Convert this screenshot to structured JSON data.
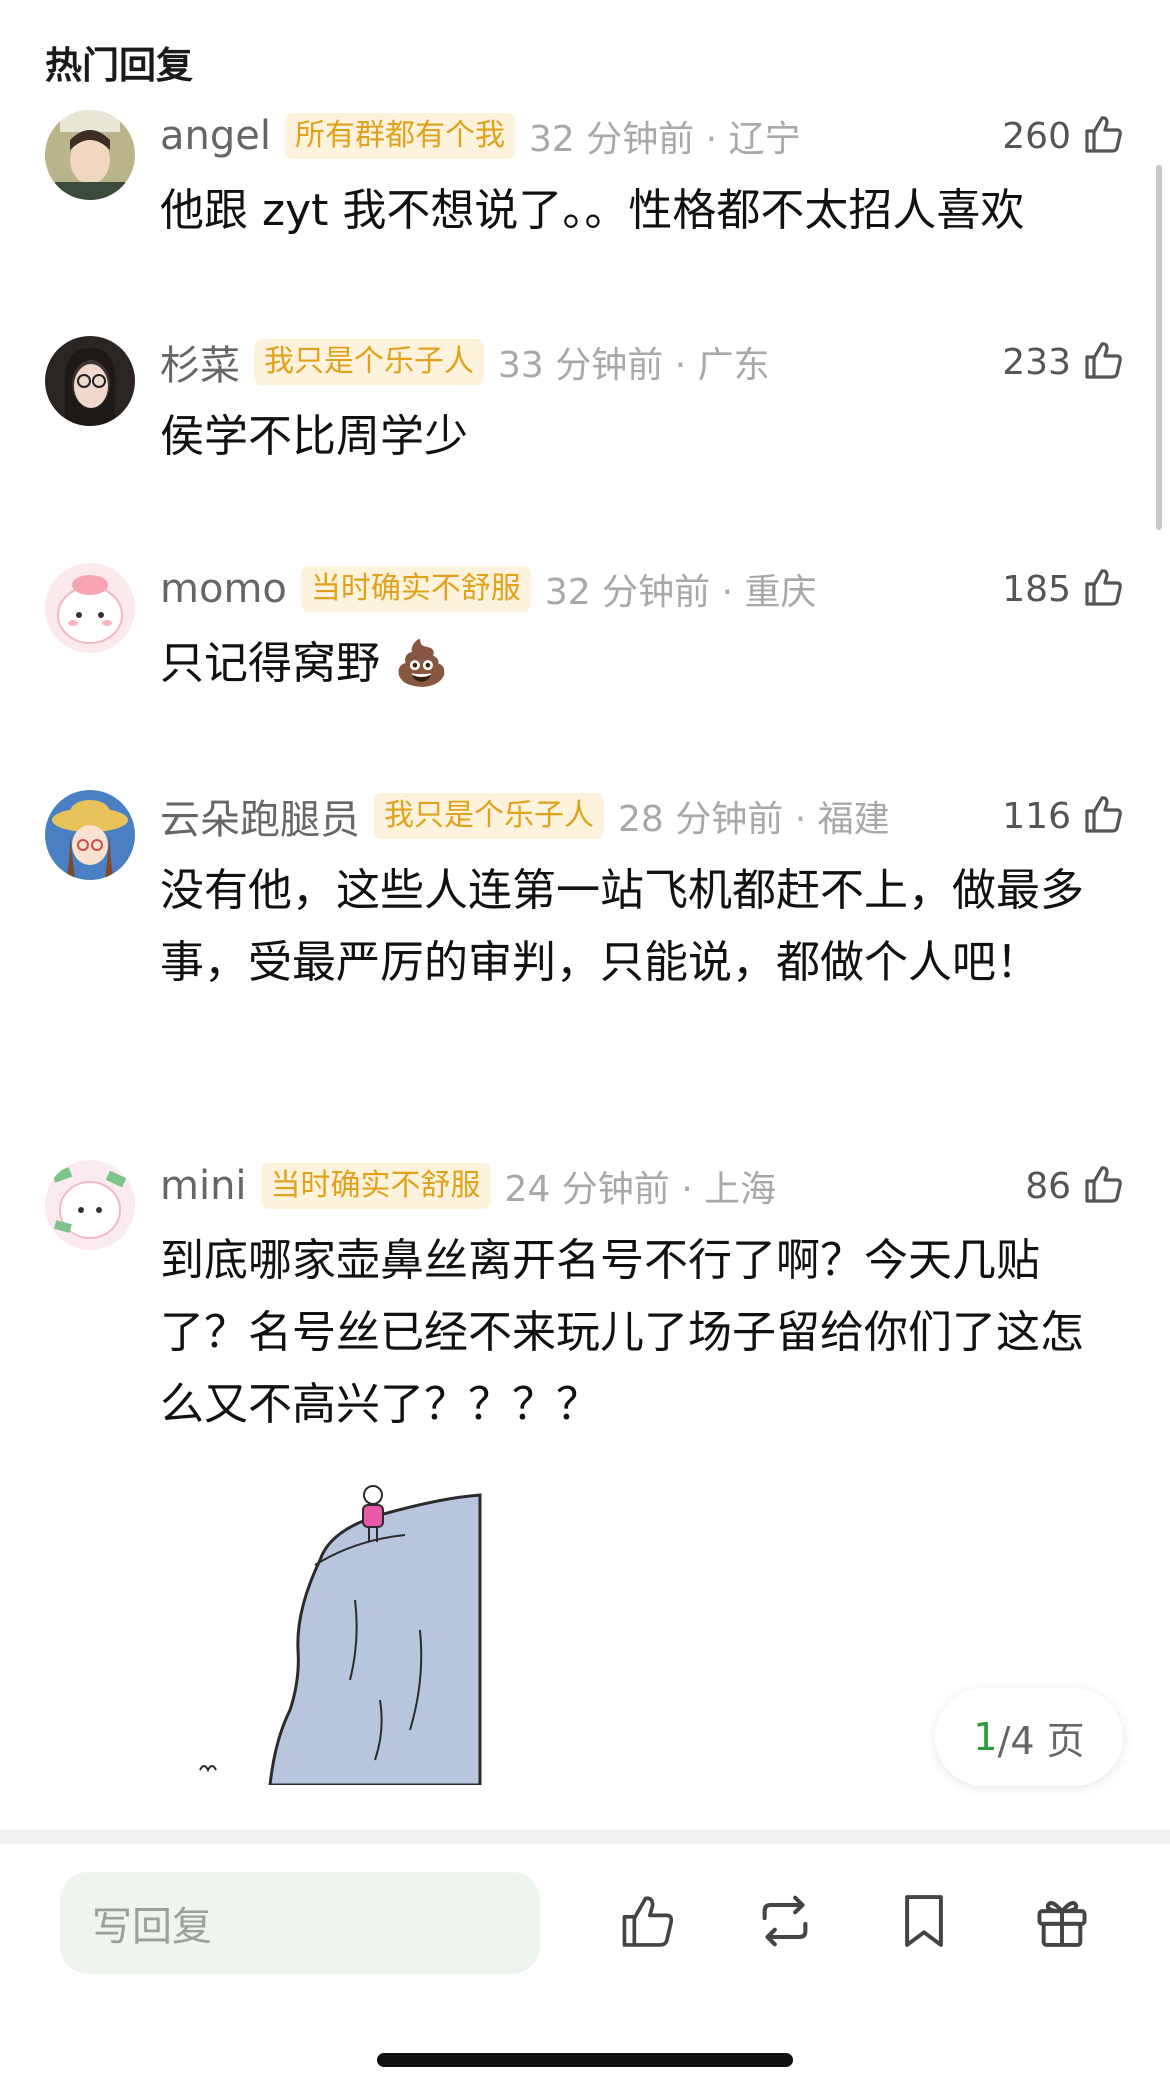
{
  "section": {
    "title": "热门回复"
  },
  "comments": [
    {
      "username": "angel",
      "badge": "所有群都有个我",
      "time_location": "32 分钟前 · 辽宁",
      "likes": "260",
      "text": "他跟 zyt 我不想说了。。性格都不太招人喜欢",
      "avatar": "avatar-girl-hat"
    },
    {
      "username": "杉菜",
      "badge": "我只是个乐子人",
      "time_location": "33 分钟前 · 广东",
      "likes": "233",
      "text": "侯学不比周学少",
      "avatar": "avatar-girl-glasses"
    },
    {
      "username": "momo",
      "badge": "当时确实不舒服",
      "time_location": "32 分钟前 · 重庆",
      "likes": "185",
      "text": "只记得窝野 💩",
      "avatar": "avatar-pink-cartoon"
    },
    {
      "username": "云朵跑腿员",
      "badge": "我只是个乐子人",
      "time_location": "28 分钟前 · 福建",
      "likes": "116",
      "text": "没有他，这些人连第一站飞机都赶不上，做最多事，受最严厉的审判，只能说，都做个人吧！",
      "avatar": "avatar-cartoon-girl-hat"
    },
    {
      "username": "mini",
      "badge": "当时确实不舒服",
      "time_location": "24 分钟前 · 上海",
      "likes": "86",
      "text": "到底哪家壶鼻丝离开名号不行了啊？今天几贴了？名号丝已经不来玩儿了场子留给你们了这怎么又不高兴了？？？？",
      "avatar": "avatar-pink-money"
    }
  ],
  "pagination": {
    "current": "1",
    "total_suffix": "/4 页"
  },
  "bottom_bar": {
    "reply_placeholder": "写回复",
    "icons": [
      "thumbs-up-icon",
      "repost-icon",
      "bookmark-icon",
      "gift-icon"
    ]
  },
  "colors": {
    "badge_text": "#e0a21c",
    "badge_bg": "#fdf3dc",
    "page_current": "#2e9b3c",
    "reply_input_bg": "#eef5ef"
  }
}
